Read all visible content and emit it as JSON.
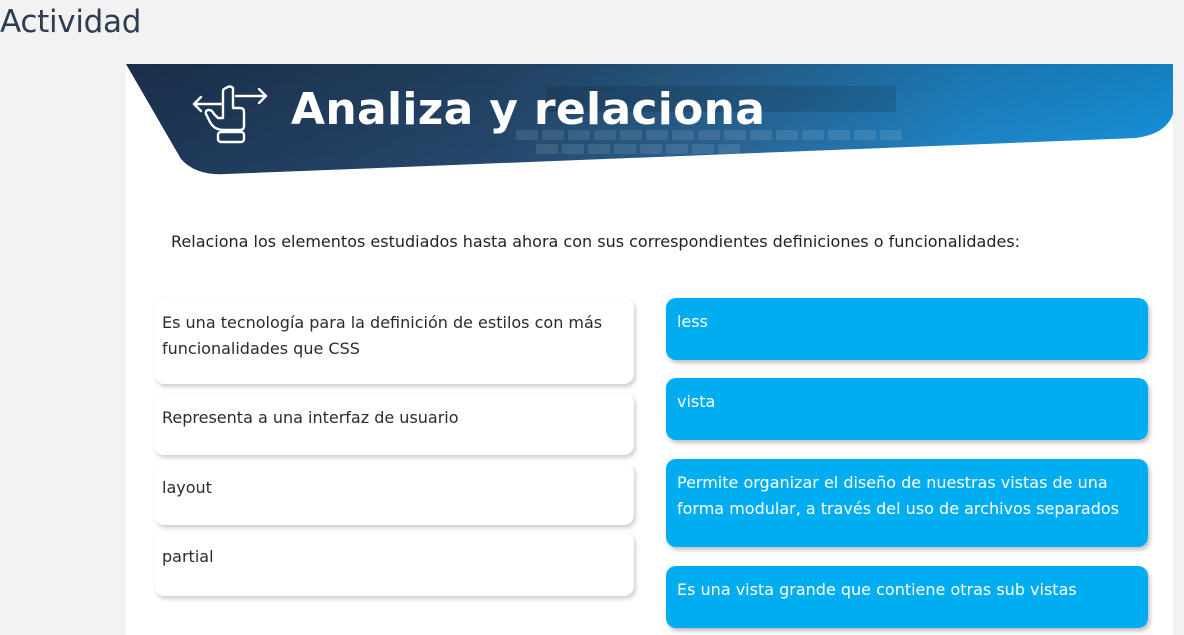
{
  "page": {
    "title": "Actividad"
  },
  "activity": {
    "banner_title": "Analiza y relaciona",
    "banner_icon": "hand-pointing-arrows-icon",
    "instructions": "Relaciona los elementos estudiados hasta ahora con sus correspondientes definiciones o funcionalidades:",
    "left_items": [
      {
        "text": "Es una tecnología para la definición de estilos con más funcionalidades que CSS"
      },
      {
        "text": "Representa a una interfaz de usuario"
      },
      {
        "text": "layout"
      },
      {
        "text": "partial"
      }
    ],
    "right_items": [
      {
        "text": "less"
      },
      {
        "text": "vista"
      },
      {
        "text": "Permite organizar el diseño de nuestras vistas de una forma modular, a través del uso de archivos separados"
      },
      {
        "text": "Es una vista grande que contiene otras sub vistas"
      }
    ]
  },
  "colors": {
    "banner_dark": "#1d3a5c",
    "banner_light": "#1a8fd6",
    "right_item_bg": "#00adf0",
    "left_item_bg": "#ffffff",
    "page_bg": "#f2f2f2"
  }
}
